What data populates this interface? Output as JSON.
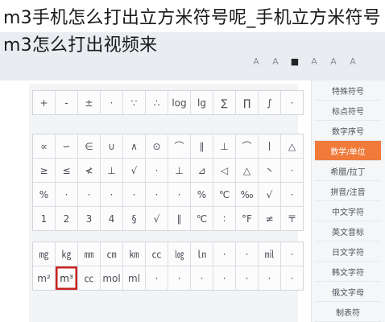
{
  "title": "m3手机怎么打出立方米符号呢_手机立方米符号m3怎么打出视频来",
  "toolbar": {
    "buttons": [
      "A",
      "A",
      "■",
      "A",
      "A",
      "A"
    ]
  },
  "grids": {
    "a": [
      "+",
      "-",
      "±",
      "·",
      "∵",
      "∴",
      "log",
      "lg",
      "∑",
      "∏",
      "∫",
      "·"
    ],
    "b": [
      "∝",
      "∽",
      "∈",
      "∪",
      "∧",
      "⊙",
      "⌒",
      "∥",
      "⊥",
      "⌒",
      "丨",
      "△",
      "≥",
      "≤",
      "≮",
      "⊥",
      "√",
      "·",
      "⊥",
      "⊿",
      "◁",
      "△",
      "丶",
      "·",
      "%",
      "·",
      "·",
      "·",
      "·",
      "·",
      "·",
      "%",
      "℃",
      "‰",
      "√",
      "·",
      "1",
      "2",
      "3",
      "4",
      "§",
      "√",
      "∥",
      "℃",
      "∶",
      "°F",
      "≠",
      "〒"
    ],
    "c": [
      "㎎",
      "㎏",
      "㎜",
      "㎝",
      "㎞",
      "㏄",
      "㏒",
      "㏑",
      "·",
      "·",
      "㏕",
      "·",
      "m²",
      "m³",
      "㏄",
      "mol",
      "ml",
      "·",
      "·",
      "·",
      "·",
      "·",
      "·",
      "·"
    ]
  },
  "categories": [
    {
      "label": "特殊符号",
      "active": false
    },
    {
      "label": "标点符号",
      "active": false
    },
    {
      "label": "数字序号",
      "active": false
    },
    {
      "label": "数学/单位",
      "active": true
    },
    {
      "label": "希腊/拉丁",
      "active": false
    },
    {
      "label": "拼音/注音",
      "active": false
    },
    {
      "label": "中文字符",
      "active": false
    },
    {
      "label": "英文音标",
      "active": false
    },
    {
      "label": "日文字符",
      "active": false
    },
    {
      "label": "韩文字符",
      "active": false
    },
    {
      "label": "俄文字母",
      "active": false
    },
    {
      "label": "制表符",
      "active": false
    }
  ]
}
